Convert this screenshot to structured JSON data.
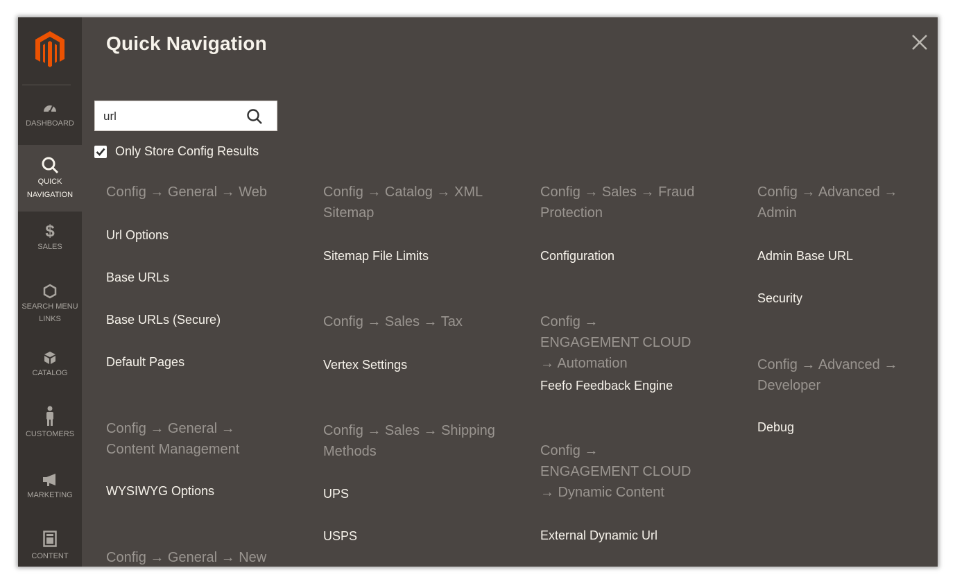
{
  "sidebar": {
    "items": [
      {
        "label": "DASHBOARD",
        "icon": "gauge-icon"
      },
      {
        "label": "QUICK NAVIGATION",
        "icon": "search-icon",
        "active": true
      },
      {
        "label": "SALES",
        "icon": "dollar-icon"
      },
      {
        "label": "SEARCH MENU LINKS",
        "icon": "hexagon-icon"
      },
      {
        "label": "CATALOG",
        "icon": "cube-icon"
      },
      {
        "label": "CUSTOMERS",
        "icon": "person-icon"
      },
      {
        "label": "MARKETING",
        "icon": "megaphone-icon"
      },
      {
        "label": "CONTENT",
        "icon": "layout-icon"
      }
    ]
  },
  "header": {
    "title": "Quick Navigation"
  },
  "search": {
    "value": "url"
  },
  "filter": {
    "label": "Only Store Config Results",
    "checked": true
  },
  "columns": [
    {
      "groups": [
        {
          "title": "Config → General → Web",
          "links": [
            "Url Options",
            "Base URLs",
            "Base URLs (Secure)",
            "Default Pages"
          ]
        },
        {
          "title": "Config → General → Content Management",
          "links": [
            "WYSIWYG Options"
          ]
        },
        {
          "title": "Config → General → New",
          "links": []
        }
      ]
    },
    {
      "groups": [
        {
          "title": "Config → Catalog → XML Sitemap",
          "links": [
            "Sitemap File Limits"
          ]
        },
        {
          "title": "Config → Sales → Tax",
          "links": [
            "Vertex Settings"
          ]
        },
        {
          "title": "Config → Sales → Shipping Methods",
          "links": [
            "UPS",
            "USPS"
          ]
        }
      ]
    },
    {
      "groups": [
        {
          "title": "Config → Sales → Fraud Protection",
          "links": [
            "Configuration"
          ]
        },
        {
          "title": "Config → ENGAGEMENT CLOUD → Automation",
          "links": [
            "Feefo Feedback Engine"
          ]
        },
        {
          "title": "Config → ENGAGEMENT CLOUD → Dynamic Content",
          "links": [
            "External Dynamic Url"
          ]
        }
      ]
    },
    {
      "groups": [
        {
          "title": "Config → Advanced → Admin",
          "links": [
            "Admin Base URL",
            "Security"
          ]
        },
        {
          "title": "Config → Advanced → Developer",
          "links": [
            "Debug"
          ]
        }
      ]
    }
  ],
  "colors": {
    "panel": "#4a4542",
    "sidebar": "#373330",
    "accent": "#eb5202",
    "group_title": "#9a9590",
    "link": "#f7f3eb"
  }
}
